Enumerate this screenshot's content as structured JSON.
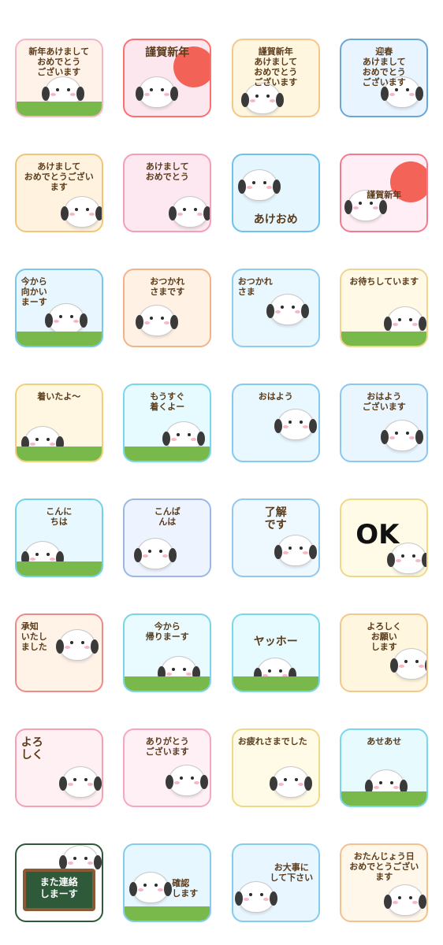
{
  "stickers": [
    {
      "text": "新年あけまして\nおめでとう\nございます",
      "bg": "#fff3e9",
      "accent": "#f3b7c8"
    },
    {
      "text": "謹賀新年",
      "bg": "#fde7ef",
      "accent": "#ff6e6e"
    },
    {
      "text": "謹賀新年\nあけまして\nおめでとう\nございます",
      "bg": "#fff6e0",
      "accent": "#f4c88a"
    },
    {
      "text": "迎春\nあけまして\nおめでとう\nございます",
      "bg": "#e8f4ff",
      "accent": "#6aa7d8"
    },
    {
      "text": "あけまして\nおめでとうございます",
      "bg": "#fff3df",
      "accent": "#f1c57a"
    },
    {
      "text": "あけまして\nおめでとう",
      "bg": "#fde7f1",
      "accent": "#f1a0b8"
    },
    {
      "text": "あけおめ",
      "bg": "#e6f6ff",
      "accent": "#6ec3ea"
    },
    {
      "text": "謹賀新年",
      "bg": "#ffeef5",
      "accent": "#f47a8e"
    },
    {
      "text": "今から\n向かい\nまーす",
      "bg": "#e8f6ff",
      "accent": "#79c7ea"
    },
    {
      "text": "おつかれ\nさまです",
      "bg": "#fff2e5",
      "accent": "#f2b38b"
    },
    {
      "text": "おつかれ\nさま",
      "bg": "#e9f7ff",
      "accent": "#90cdea"
    },
    {
      "text": "お待ちしています",
      "bg": "#fff9e6",
      "accent": "#f2d38f"
    },
    {
      "text": "着いたよ〜",
      "bg": "#fff7e1",
      "accent": "#f2d07a"
    },
    {
      "text": "もうすぐ\n着くよー",
      "bg": "#e6fbff",
      "accent": "#78d8ea"
    },
    {
      "text": "おはよう",
      "bg": "#e9f7ff",
      "accent": "#86c9ee"
    },
    {
      "text": "おはよう\nございます",
      "bg": "#eaf6ff",
      "accent": "#8cc7ef"
    },
    {
      "text": "こんに\nちは",
      "bg": "#e7f9ff",
      "accent": "#74d1ea"
    },
    {
      "text": "こんば\nんは",
      "bg": "#eef4ff",
      "accent": "#9ab7e6"
    },
    {
      "text": "了解\nです",
      "bg": "#eef8ff",
      "accent": "#93c7ec"
    },
    {
      "text": "OK",
      "bg": "#fffbe6",
      "accent": "#f1d788"
    },
    {
      "text": "承知\nいたし\nました",
      "bg": "#fff3e8",
      "accent": "#ef8a8a"
    },
    {
      "text": "今から\n帰りまーす",
      "bg": "#e9fbff",
      "accent": "#7ad4ea"
    },
    {
      "text": "ヤッホー",
      "bg": "#e6fbff",
      "accent": "#78d8ea"
    },
    {
      "text": "よろしく\nお願い\nします",
      "bg": "#fff6df",
      "accent": "#f2c98a"
    },
    {
      "text": "よろ\nしく",
      "bg": "#fff0f3",
      "accent": "#f4a1b3"
    },
    {
      "text": "ありがとう\nございます",
      "bg": "#fff0f6",
      "accent": "#f6a6c4"
    },
    {
      "text": "お疲れさまでした",
      "bg": "#fffbe6",
      "accent": "#f1d788"
    },
    {
      "text": "あせあせ",
      "bg": "#e7fbff",
      "accent": "#7ad6ea"
    },
    {
      "text": "また連絡\nしまーす",
      "bg": "#ffffff",
      "accent": "#2e5a3a"
    },
    {
      "text": "確認\nします",
      "bg": "#e7f7ff",
      "accent": "#84cbee"
    },
    {
      "text": "お大事に\nして下さい",
      "bg": "#e8f7ff",
      "accent": "#86cbee"
    },
    {
      "text": "おたんじょう日\nおめでとうございます",
      "bg": "#fff7ea",
      "accent": "#f3c18e"
    }
  ]
}
